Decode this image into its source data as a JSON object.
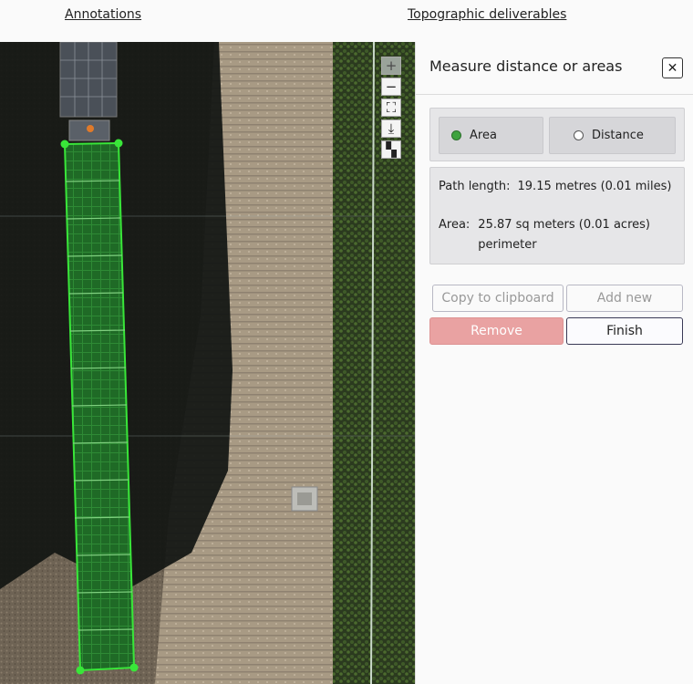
{
  "nav": {
    "annotations": "Annotations",
    "topographic": "Topographic deliverables"
  },
  "map": {
    "controls": {
      "zoom_in": "+",
      "zoom_out": "−",
      "fit": "⛶",
      "download": "⤓",
      "layers": "▚"
    },
    "polygon_color": "#39e639"
  },
  "panel": {
    "title": "Measure distance or areas",
    "close": "✕",
    "mode": {
      "area_label": "Area",
      "distance_label": "Distance",
      "selected": "Area"
    },
    "info": {
      "path_label": "Path length:",
      "path_value": "19.15 metres (0.01 miles)",
      "area_label": "Area:",
      "area_value_line1": "25.87 sq meters (0.01 acres)",
      "area_value_line2": "perimeter"
    },
    "buttons": {
      "copy": "Copy to clipboard",
      "add": "Add new",
      "remove": "Remove",
      "finish": "Finish"
    }
  },
  "colors": {
    "remove_bg": "#e9a2a2",
    "radio_on": "#3fa33f"
  }
}
